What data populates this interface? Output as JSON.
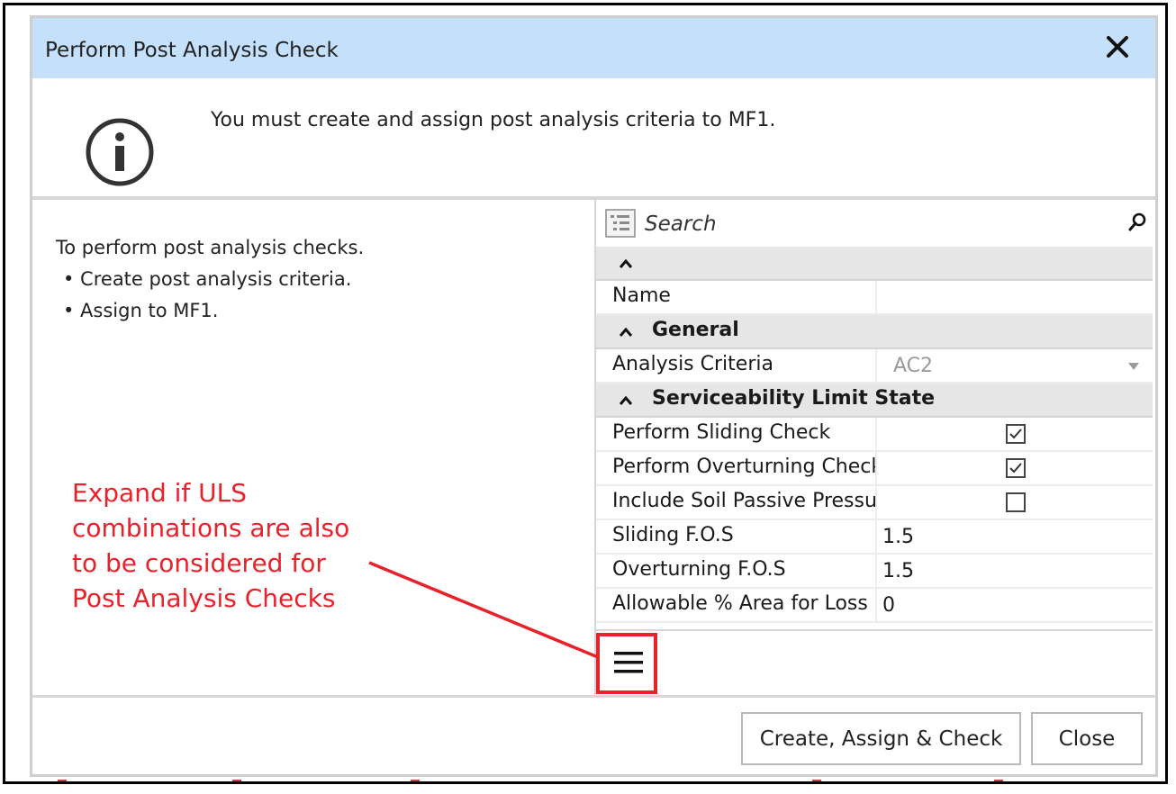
{
  "dialog": {
    "title": "Perform Post Analysis Check",
    "message": "You must create and assign post analysis criteria to MF1."
  },
  "instructions": {
    "heading": "To perform post analysis checks.",
    "steps": [
      "• Create post analysis criteria.",
      "• Assign to MF1."
    ]
  },
  "grid": {
    "search_placeholder": "Search",
    "rows": [
      {
        "type": "category",
        "label": ""
      },
      {
        "type": "text",
        "name": "Name",
        "value": ""
      },
      {
        "type": "category",
        "label": "General"
      },
      {
        "type": "dropdown",
        "name": "Analysis Criteria",
        "value": "AC2"
      },
      {
        "type": "category",
        "label": "Serviceability Limit State"
      },
      {
        "type": "checkbox",
        "name": "Perform Sliding Check",
        "checked": true
      },
      {
        "type": "checkbox",
        "name": "Perform Overturning Check",
        "checked": true
      },
      {
        "type": "checkbox",
        "name": "Include Soil Passive Pressure",
        "checked": false
      },
      {
        "type": "text",
        "name": "Sliding F.O.S",
        "value": "1.5"
      },
      {
        "type": "text",
        "name": "Overturning F.O.S",
        "value": "1.5"
      },
      {
        "type": "text",
        "name": "Allowable % Area for Loss of Contact",
        "value": "0"
      }
    ]
  },
  "buttons": {
    "create_assign_check": "Create, Assign & Check",
    "close": "Close"
  },
  "annotation": {
    "text_lines": [
      "Expand if ULS",
      "combinations are also",
      "to be considered for",
      "Post Analysis Checks"
    ],
    "color": "#e8222b"
  },
  "colors": {
    "titlebar": "#c5e0fa",
    "category_row": "#e6e6e6",
    "highlight": "#e8222b"
  },
  "icons": {
    "info": "info-circle-icon",
    "close": "close-icon",
    "list": "property-list-icon",
    "search": "search-icon",
    "menu": "hamburger-menu-icon"
  }
}
